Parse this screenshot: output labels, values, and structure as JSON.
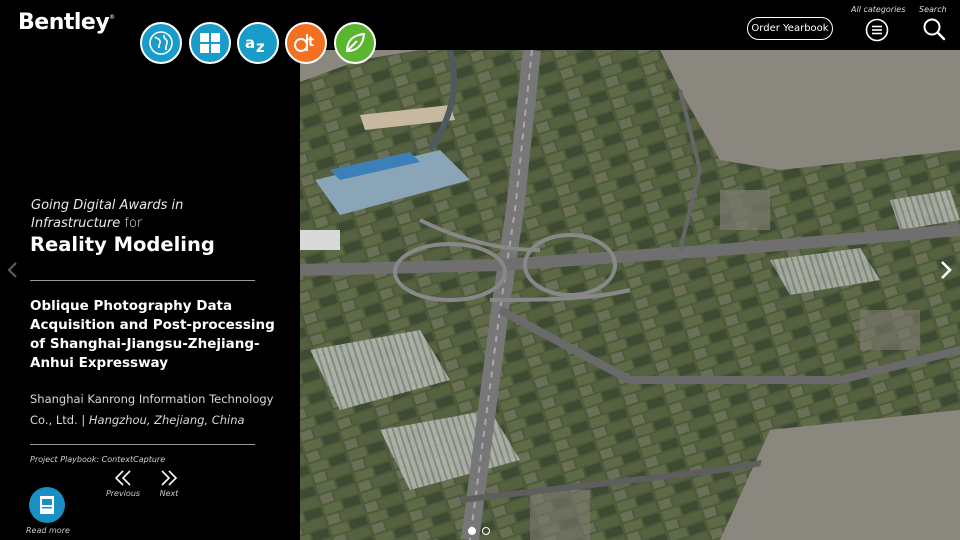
{
  "brand": {
    "name": "Bentley",
    "trademark": "®"
  },
  "category_icons": [
    {
      "name": "globe-icon",
      "color": "#1a9ccb"
    },
    {
      "name": "grid-icon",
      "color": "#1a9ccb"
    },
    {
      "name": "az-icon",
      "color": "#1a9ccb"
    },
    {
      "name": "dt-icon",
      "color": "#f36f21"
    },
    {
      "name": "leaf-icon",
      "color": "#5ab62e"
    }
  ],
  "header": {
    "order_yearbook_label": "Order Yearbook",
    "all_categories_label": "All categories",
    "search_label": "Search"
  },
  "panel": {
    "award_line_1": "Going Digital Awards in",
    "award_line_2": "Infrastructure",
    "award_for": "for",
    "award_category": "Reality Modeling",
    "project_title_lines": [
      "Oblique Photography Data",
      "Acquisition and Post-processing",
      "of Shanghai-Jiangsu-Zhejiang-",
      "Anhui Expressway"
    ],
    "organization_line_1": "Shanghai Kanrong Information Technology",
    "organization_line_2": "Co., Ltd. | ",
    "location": "Hangzhou, Zhejiang, China",
    "playbook": "Project Playbook: ContextCapture",
    "previous_label": "Previous",
    "next_label": "Next",
    "read_more_label": "Read more"
  },
  "carousel": {
    "slides": 2,
    "active_slide": 1
  },
  "colors": {
    "accent_blue": "#1a9ccb",
    "panel_bg": "#000000",
    "terrain_void": "#8a877f"
  }
}
